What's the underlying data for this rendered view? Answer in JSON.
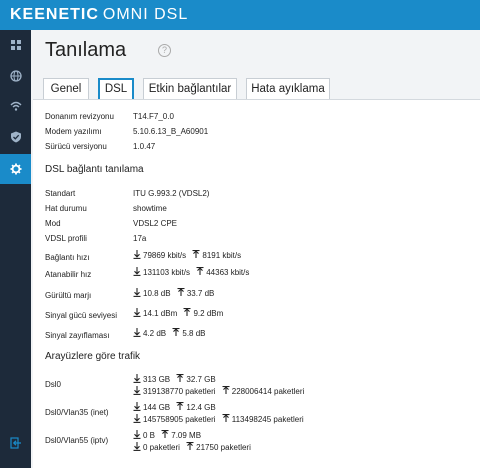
{
  "header": {
    "brand": "KEENETIC",
    "model": "OMNI DSL"
  },
  "sidebar": {
    "items": [
      {
        "icon": "dashboard-icon",
        "active": false
      },
      {
        "icon": "globe-icon",
        "active": false
      },
      {
        "icon": "wifi-icon",
        "active": false
      },
      {
        "icon": "shield-icon",
        "active": false
      },
      {
        "icon": "gear-icon",
        "active": true
      }
    ],
    "footer_icon": "logout-icon"
  },
  "page": {
    "title": "Tanılama",
    "help": "?"
  },
  "tabs": [
    {
      "label": "Genel",
      "active": false
    },
    {
      "label": "DSL",
      "active": true
    },
    {
      "label": "Etkin bağlantılar",
      "active": false
    },
    {
      "label": "Hata ayıklama",
      "active": false
    }
  ],
  "device": [
    {
      "label": "Donanım revizyonu",
      "value": "T14.F7_0.0"
    },
    {
      "label": "Modem yazılımı",
      "value": "5.10.6.13_B_A60901"
    },
    {
      "label": "Sürücü versiyonu",
      "value": "1.0.47"
    }
  ],
  "dsl": {
    "title": "DSL bağlantı tanılama",
    "rows": [
      {
        "label": "Standart",
        "value": "ITU G.993.2 (VDSL2)"
      },
      {
        "label": "Hat durumu",
        "value": "showtime"
      },
      {
        "label": "Mod",
        "value": "VDSL2 CPE"
      },
      {
        "label": "VDSL profili",
        "value": "17a"
      }
    ],
    "metrics": [
      {
        "label": "Bağlantı hızı",
        "down": "79869 kbit/s",
        "up": "8191 kbit/s"
      },
      {
        "label": "Atanabilir hız",
        "down": "131103 kbit/s",
        "up": "44363 kbit/s"
      },
      {
        "label": "Gürültü marjı",
        "down": "10.8 dB",
        "up": "33.7 dB"
      },
      {
        "label": "Sinyal gücü seviyesi",
        "down": "14.1 dBm",
        "up": "9.2 dBm"
      },
      {
        "label": "Sinyal zayıflaması",
        "down": "4.2 dB",
        "up": "5.8 dB"
      }
    ]
  },
  "traffic": {
    "title": "Arayüzlere göre trafik",
    "rows": [
      {
        "label": "Dsl0",
        "down_bytes": "313 GB",
        "up_bytes": "32.7 GB",
        "down_packets": "319138770 paketleri",
        "up_packets": "228006414 paketleri"
      },
      {
        "label": "Dsl0/Vlan35 (inet)",
        "down_bytes": "144 GB",
        "up_bytes": "12.4 GB",
        "down_packets": "145758905 paketleri",
        "up_packets": "113498245 paketleri"
      },
      {
        "label": "Dsl0/Vlan55 (iptv)",
        "down_bytes": "0 B",
        "up_bytes": "7.09 MB",
        "down_packets": "0 paketleri",
        "up_packets": "21750 paketleri"
      }
    ]
  },
  "colors": {
    "accent": "#1a8bc9",
    "sidebar": "#1d2a3a"
  }
}
